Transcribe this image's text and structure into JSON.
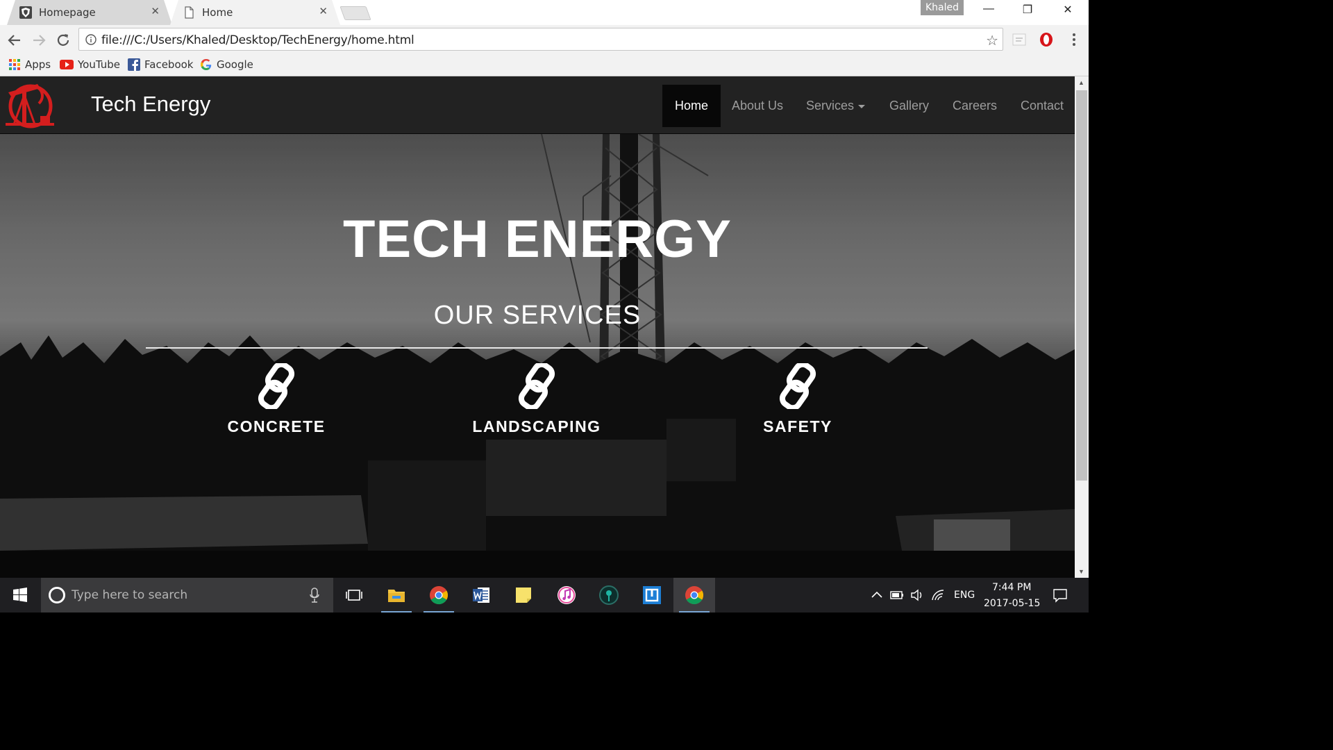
{
  "browser": {
    "tabs": [
      {
        "title": "Homepage",
        "active": false
      },
      {
        "title": "Home",
        "active": true
      }
    ],
    "profile_name": "Khaled",
    "url": "file:///C:/Users/Khaled/Desktop/TechEnergy/home.html",
    "bookmarks": [
      {
        "label": "Apps",
        "icon": "apps-grid-icon"
      },
      {
        "label": "YouTube",
        "icon": "youtube-icon"
      },
      {
        "label": "Facebook",
        "icon": "facebook-icon"
      },
      {
        "label": "Google",
        "icon": "google-icon"
      }
    ]
  },
  "site": {
    "brand": "Tech Energy",
    "nav": [
      {
        "label": "Home",
        "active": true
      },
      {
        "label": "About Us"
      },
      {
        "label": "Services",
        "dropdown": true
      },
      {
        "label": "Gallery"
      },
      {
        "label": "Careers"
      },
      {
        "label": "Contact"
      }
    ],
    "hero": {
      "title": "TECH ENERGY",
      "subtitle": "OUR SERVICES",
      "services": [
        {
          "label": "CONCRETE",
          "icon": "link-icon"
        },
        {
          "label": "LANDSCAPING",
          "icon": "link-icon"
        },
        {
          "label": "SAFETY",
          "icon": "link-icon"
        }
      ]
    },
    "colors": {
      "logo": "#d41e1e",
      "navbar": "#222222",
      "nav_active": "#080808"
    }
  },
  "taskbar": {
    "search_placeholder": "Type here to search",
    "apps": [
      "task-view",
      "file-explorer",
      "chrome",
      "word",
      "sticky-notes",
      "itunes",
      "unknown-app",
      "unknown-app-2",
      "chrome"
    ],
    "language": "ENG",
    "time": "7:44 PM",
    "date": "2017-05-15"
  }
}
